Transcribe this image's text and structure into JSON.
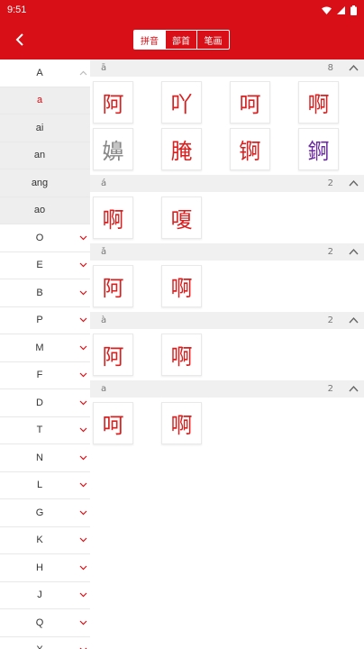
{
  "status": {
    "time": "9:51"
  },
  "header": {
    "tabs": [
      "拼音",
      "部首",
      "笔画"
    ]
  },
  "index": {
    "groupA": {
      "letter": "A",
      "subs": [
        "a",
        "ai",
        "an",
        "ang",
        "ao"
      ]
    },
    "letters": [
      "O",
      "E",
      "B",
      "P",
      "M",
      "F",
      "D",
      "T",
      "N",
      "L",
      "G",
      "K",
      "H",
      "J",
      "Q",
      "X"
    ]
  },
  "sections": [
    {
      "pinyin": "ā",
      "count": "8",
      "chars": [
        "阿",
        "吖",
        "呵",
        "啊",
        "嬶",
        "腌",
        "锕",
        "錒"
      ]
    },
    {
      "pinyin": "á",
      "count": "2",
      "chars": [
        "啊",
        "嗄"
      ]
    },
    {
      "pinyin": "ǎ",
      "count": "2",
      "chars": [
        "阿",
        "啊"
      ]
    },
    {
      "pinyin": "à",
      "count": "2",
      "chars": [
        "阿",
        "啊"
      ]
    },
    {
      "pinyin": "a",
      "count": "2",
      "chars": [
        "呵",
        "啊"
      ]
    }
  ],
  "colors": {
    "brand": "#d80f16",
    "char_red": "#d82020",
    "char_gray": "#888888",
    "char_purple": "#6a2aa0"
  }
}
